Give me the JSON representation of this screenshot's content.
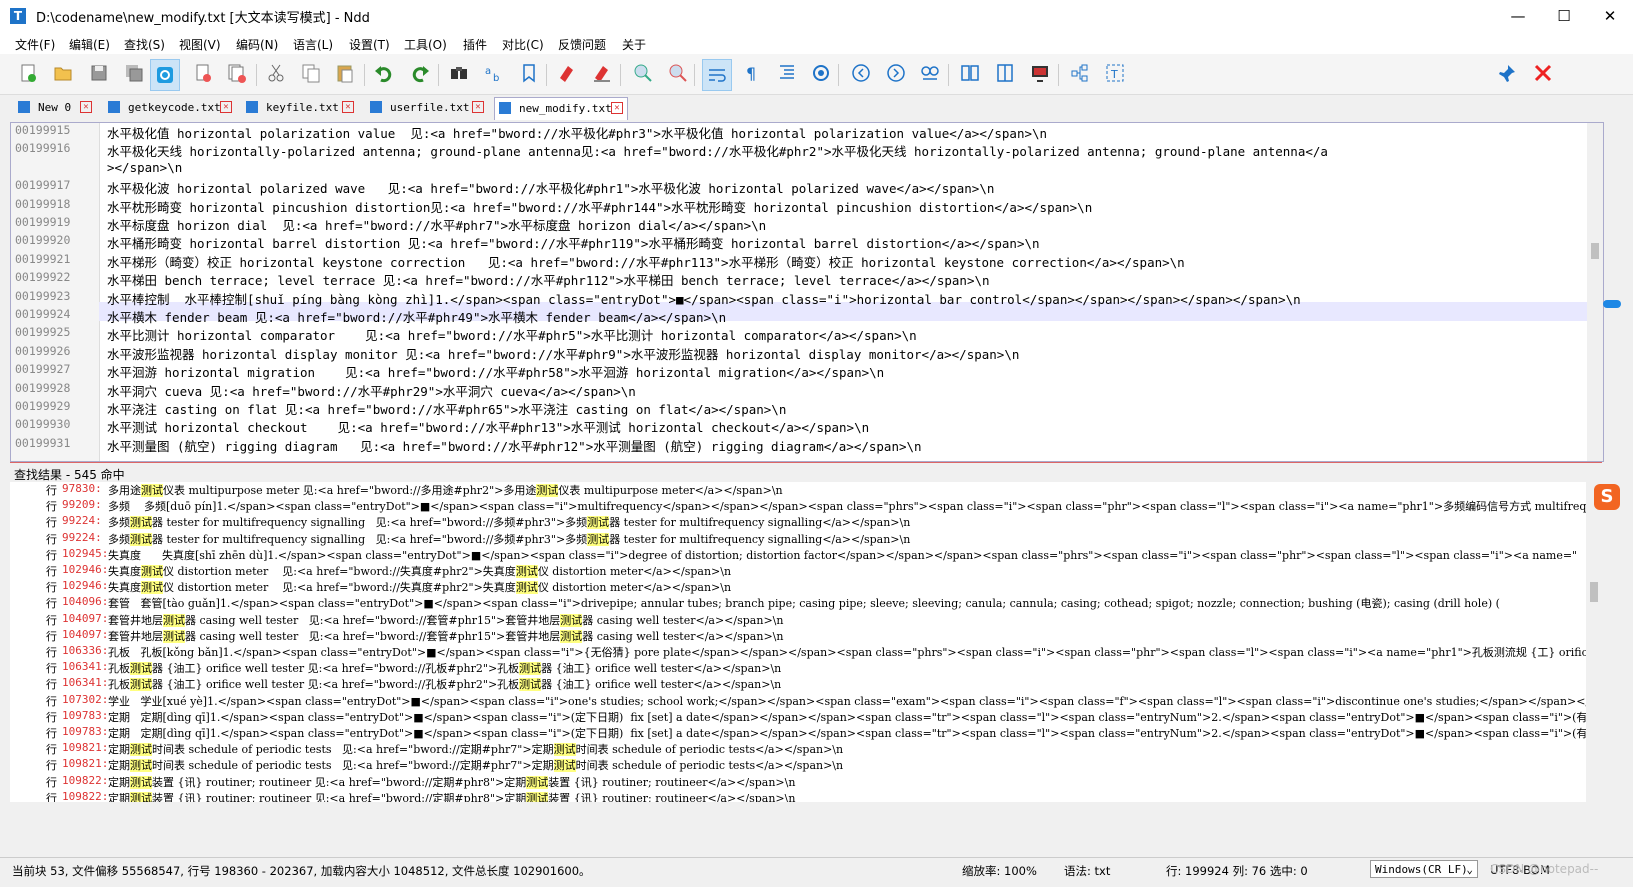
{
  "window": {
    "title": "D:\\codename\\new_modify.txt [大文本读写模式] - Ndd",
    "icon_letter": "T",
    "minimize": "—",
    "maximize": "☐",
    "close": "✕"
  },
  "menu": [
    "文件(F)",
    "编辑(E)",
    "查找(S)",
    "视图(V)",
    "编码(N)",
    "语言(L)",
    "设置(T)",
    "工具(O)",
    "插件",
    "对比(C)",
    "反馈问题",
    "关于"
  ],
  "tabs": [
    {
      "label": "New 0",
      "active": false
    },
    {
      "label": "getkeycode.txt",
      "active": false
    },
    {
      "label": "keyfile.txt",
      "active": false
    },
    {
      "label": "userfile.txt",
      "active": false
    },
    {
      "label": "new_modify.txt",
      "active": true
    }
  ],
  "editor": {
    "current_line": "00199924",
    "lines": [
      {
        "num": "00199915",
        "text": "水平极化值 horizontal polarization value  见:<a href=\"bword://水平极化#phr3\">水平极化值 horizontal polarization value</a></span>\\n"
      },
      {
        "num": "00199916",
        "text": "水平极化天线 horizontally-polarized antenna; ground-plane antenna见:<a href=\"bword://水平极化#phr2\">水平极化天线 horizontally-polarized antenna; ground-plane antenna</a"
      },
      {
        "num": "",
        "text": "></span>\\n"
      },
      {
        "num": "00199917",
        "text": "水平极化波 horizontal polarized wave   见:<a href=\"bword://水平极化#phr1\">水平极化波 horizontal polarized wave</a></span>\\n"
      },
      {
        "num": "00199918",
        "text": "水平枕形畸变 horizontal pincushion distortion见:<a href=\"bword://水平#phr144\">水平枕形畸变 horizontal pincushion distortion</a></span>\\n"
      },
      {
        "num": "00199919",
        "text": "水平标度盘 horizon dial  见:<a href=\"bword://水平#phr7\">水平标度盘 horizon dial</a></span>\\n"
      },
      {
        "num": "00199920",
        "text": "水平桶形畸变 horizontal barrel distortion 见:<a href=\"bword://水平#phr119\">水平桶形畸变 horizontal barrel distortion</a></span>\\n"
      },
      {
        "num": "00199921",
        "text": "水平梯形（畸变）校正 horizontal keystone correction   见:<a href=\"bword://水平#phr113\">水平梯形（畸变）校正 horizontal keystone correction</a></span>\\n"
      },
      {
        "num": "00199922",
        "text": "水平梯田 bench terrace; level terrace 见:<a href=\"bword://水平#phr112\">水平梯田 bench terrace; level terrace</a></span>\\n"
      },
      {
        "num": "00199923",
        "text": "水平棒控制  水平棒控制[shuǐ píng bàng kòng zhì]1.</span><span class=\"entryDot\">■</span><span class=\"i\">horizontal bar control</span></span></span></span></span>\\n"
      },
      {
        "num": "00199924",
        "text": "水平横木 fender beam 见:<a href=\"bword://水平#phr49\">水平横木 fender beam</a></span>\\n"
      },
      {
        "num": "00199925",
        "text": "水平比测计 horizontal comparator    见:<a href=\"bword://水平#phr5\">水平比测计 horizontal comparator</a></span>\\n"
      },
      {
        "num": "00199926",
        "text": "水平波形监视器 horizontal display monitor 见:<a href=\"bword://水平#phr9\">水平波形监视器 horizontal display monitor</a></span>\\n"
      },
      {
        "num": "00199927",
        "text": "水平洄游 horizontal migration    见:<a href=\"bword://水平#phr58\">水平洄游 horizontal migration</a></span>\\n"
      },
      {
        "num": "00199928",
        "text": "水平洞穴 cueva 见:<a href=\"bword://水平#phr29\">水平洞穴 cueva</a></span>\\n"
      },
      {
        "num": "00199929",
        "text": "水平浇注 casting on flat 见:<a href=\"bword://水平#phr65\">水平浇注 casting on flat</a></span>\\n"
      },
      {
        "num": "00199930",
        "text": "水平测试 horizontal checkout    见:<a href=\"bword://水平#phr13\">水平测试 horizontal checkout</a></span>\\n"
      },
      {
        "num": "00199931",
        "text": "水平测量图 (航空) rigging diagram   见:<a href=\"bword://水平#phr12\">水平测量图 (航空) rigging diagram</a></span>\\n"
      }
    ]
  },
  "find": {
    "title": "查找结果 - 545 命中",
    "prefix": "行",
    "highlight": "测试",
    "lines": [
      {
        "num": "97830:",
        "text": "多用途测试仪表 multipurpose meter 见:<a href=\"bword://多用途#phr2\">多用途测试仪表 multipurpose meter</a></span>\\n"
      },
      {
        "num": "99209:",
        "text": "多频    多频[duō pín]1.</span><span class=\"entryDot\">■</span><span class=\"i\">multifrequency</span></span></span><span class=\"phrs\"><span class=\"i\"><span class=\"phr\"><span class=\"l\"><span class=\"i\"><a name=\"phr1\">多频编码信号方式 multifrequency"
      },
      {
        "num": "99224:",
        "text": "多频测试器 tester for multifrequency signalling   见:<a href=\"bword://多频#phr3\">多频测试器 tester for multifrequency signalling</a></span>\\n"
      },
      {
        "num": "99224:",
        "text": "多频测试器 tester for multifrequency signalling   见:<a href=\"bword://多频#phr3\">多频测试器 tester for multifrequency signalling</a></span>\\n"
      },
      {
        "num": "102945:",
        "text": "失真度      失真度[shī zhēn dù]1.</span><span class=\"entryDot\">■</span><span class=\"i\">degree of distortion; distortion factor</span></span></span><span class=\"phrs\"><span class=\"i\"><span class=\"phr\"><span class=\"l\"><span class=\"i\"><a name=\""
      },
      {
        "num": "102946:",
        "text": "失真度测试仪 distortion meter    见:<a href=\"bword://失真度#phr2\">失真度测试仪 distortion meter</a></span>\\n"
      },
      {
        "num": "102946:",
        "text": "失真度测试仪 distortion meter    见:<a href=\"bword://失真度#phr2\">失真度测试仪 distortion meter</a></span>\\n"
      },
      {
        "num": "104096:",
        "text": "套管   套管[tào guǎn]1.</span><span class=\"entryDot\">■</span><span class=\"i\">drivepipe; annular tubes; branch pipe; casing pipe; sleeve; sleeving; canula; cannula; casing; cothead; spigot; nozzle; connection; bushing (电瓷); casing (drill hole) ("
      },
      {
        "num": "104097:",
        "text": "套管井地层测试器 casing well tester   见:<a href=\"bword://套管#phr15\">套管井地层测试器 casing well tester</a></span>\\n"
      },
      {
        "num": "104097:",
        "text": "套管井地层测试器 casing well tester   见:<a href=\"bword://套管#phr15\">套管井地层测试器 casing well tester</a></span>\\n"
      },
      {
        "num": "106336:",
        "text": "孔板   孔板[kǒng bǎn]1.</span><span class=\"entryDot\">■</span><span class=\"i\">{无俗猜} pore plate</span></span></span><span class=\"phrs\"><span class=\"i\"><span class=\"phr\"><span class=\"l\"><span class=\"i\"><a name=\"phr1\">孔板测流规 {工} orifice ;"
      },
      {
        "num": "106341:",
        "text": "孔板测试器 {油工} orifice well tester 见:<a href=\"bword://孔板#phr2\">孔板测试器 {油工} orifice well tester</a></span>\\n"
      },
      {
        "num": "106341:",
        "text": "孔板测试器 {油工} orifice well tester 见:<a href=\"bword://孔板#phr2\">孔板测试器 {油工} orifice well tester</a></span>\\n"
      },
      {
        "num": "107302:",
        "text": "学业   学业[xué yè]1.</span><span class=\"entryDot\">■</span><span class=\"i\">one's studies; school work;</span></span><span class=\"exam\"><span class=\"i\"><span class=\"f\"><span class=\"l\"><span class=\"i\">discontinue one's studies;</span></span></span><s"
      },
      {
        "num": "109783:",
        "text": "定期   定期[dìng qī]1.</span><span class=\"entryDot\">■</span><span class=\"i\">(定下日期)  fix [set] a date</span></span></span><span class=\"tr\"><span class=\"l\"><span class=\"entryNum\">2.</span><span class=\"entryDot\">■</span><span class=\"i\">(有一定期"
      },
      {
        "num": "109783:",
        "text": "定期   定期[dìng qī]1.</span><span class=\"entryDot\">■</span><span class=\"i\">(定下日期)  fix [set] a date</span></span></span><span class=\"tr\"><span class=\"l\"><span class=\"entryNum\">2.</span><span class=\"entryDot\">■</span><span class=\"i\">(有一定期"
      },
      {
        "num": "109821:",
        "text": "定期测试时间表 schedule of periodic tests   见:<a href=\"bword://定期#phr7\">定期测试时间表 schedule of periodic tests</a></span>\\n"
      },
      {
        "num": "109821:",
        "text": "定期测试时间表 schedule of periodic tests   见:<a href=\"bword://定期#phr7\">定期测试时间表 schedule of periodic tests</a></span>\\n"
      },
      {
        "num": "109822:",
        "text": "定期测试装置 {讯} routiner; routineer 见:<a href=\"bword://定期#phr8\">定期测试装置 {讯} routiner; routineer</a></span>\\n"
      },
      {
        "num": "109822:",
        "text": "定期测试装置 {讯} routiner; routineer 见:<a href=\"bword://定期#phr8\">定期测试装置 {讯} routiner; routineer</a></span>\\n"
      }
    ]
  },
  "status": {
    "block_info": "当前块 53, 文件偏移 55568547, 行号 198360 - 202367, 加载内容大小 1048512, 文件总长度 102901600。",
    "zoom": "缩放率: 100%",
    "lang": "语法: txt",
    "position": "行: 199924 列: 76 选中: 0",
    "eol": "Windows(CR LF)",
    "encoding": "UTF8-BOM",
    "watermark": "CSDN @notepad--"
  },
  "colors": {
    "accent": "#1e73c8",
    "highlight": "#ffff80",
    "line_number_red": "#dd3333",
    "current_line_bg": "#e8e8ff"
  },
  "toolbar_icons": [
    "new-file-icon",
    "open-file-icon",
    "save-icon",
    "save-all-icon",
    "reload-icon",
    "close-file-icon",
    "close-all-icon",
    "cut-icon",
    "copy-icon",
    "paste-icon",
    "undo-icon",
    "redo-icon",
    "find-icon",
    "replace-icon",
    "bookmark-icon",
    "mark-icon",
    "clear-mark-icon",
    "zoom-in-icon",
    "zoom-out-icon",
    "wrap-icon",
    "show-symbols-icon",
    "indent-guide-icon",
    "macro-icon",
    "prev-icon",
    "next-icon",
    "goto-icon",
    "compare-dir-icon",
    "compare-file-icon",
    "compare-bin-icon",
    "structure-icon",
    "text-icon",
    "pin-icon",
    "exit-icon"
  ]
}
